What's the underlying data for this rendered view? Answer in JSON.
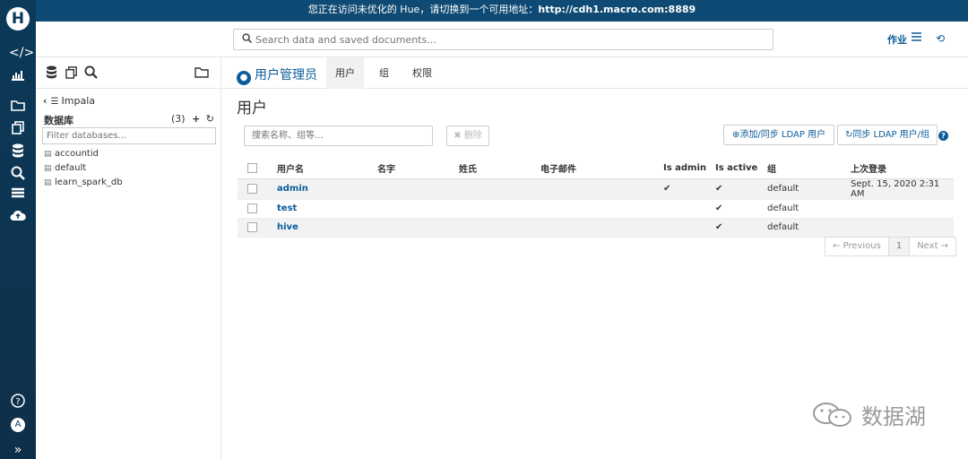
{
  "banner": {
    "text": "您正在访问未优化的 Hue，请切换到一个可用地址：",
    "url": "http://cdh1.macro.com:8889"
  },
  "leftbar": {
    "icons": [
      "hue-logo",
      "code-icon",
      "chart-icon",
      "folder-icon",
      "copy-docs-icon",
      "database-icon",
      "search-zoom-icon",
      "table-icon",
      "upload-cloud-icon",
      "help-icon",
      "avatar",
      "expand-icon"
    ],
    "avatar_letter": "A"
  },
  "topbar": {
    "search_placeholder": "Search data and saved documents...",
    "jobs_label": "作业"
  },
  "left_panel": {
    "crumb": "Impala",
    "db_header": "数据库",
    "db_count": "(3)",
    "filter_placeholder": "Filter databases...",
    "databases": [
      "accountid",
      "default",
      "learn_spark_db"
    ]
  },
  "main": {
    "app_title": "用户管理员",
    "tabs": [
      "用户",
      "组",
      "权限"
    ],
    "page_title": "用户",
    "search_placeholder": "搜索名称、组等...",
    "delete_label": "删除",
    "add_ldap_label": "添加/同步 LDAP 用户",
    "sync_ldap_label": "同步 LDAP 用户/组",
    "columns": [
      "用户名",
      "名字",
      "姓氏",
      "电子邮件",
      "Is admin",
      "Is active",
      "组",
      "上次登录"
    ],
    "rows": [
      {
        "username": "admin",
        "first": "",
        "last": "",
        "email": "",
        "is_admin": "✔",
        "is_active": "✔",
        "group": "default",
        "last_login": "Sept. 15, 2020 2:31 AM"
      },
      {
        "username": "test",
        "first": "",
        "last": "",
        "email": "",
        "is_admin": "",
        "is_active": "✔",
        "group": "default",
        "last_login": ""
      },
      {
        "username": "hive",
        "first": "",
        "last": "",
        "email": "",
        "is_admin": "",
        "is_active": "✔",
        "group": "default",
        "last_login": ""
      }
    ],
    "pager": {
      "prev": "← Previous",
      "page": "1",
      "next": "Next →"
    }
  },
  "watermark": "数据湖",
  "colors": {
    "brand": "#0b5c99",
    "sidebar": "#0b3a5a",
    "banner": "#0e4a73"
  }
}
